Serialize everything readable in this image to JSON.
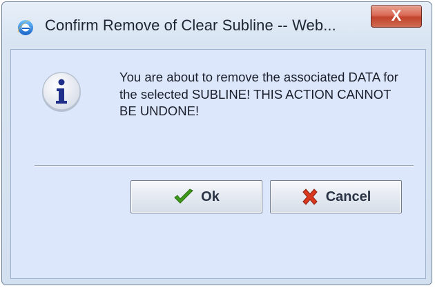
{
  "window": {
    "title": "Confirm Remove of Clear Subline -- Web...",
    "close_label": "X"
  },
  "dialog": {
    "icon": "info-icon",
    "message": "You are about to remove the associated DATA for the selected SUBLINE! THIS ACTION CANNOT BE UNDONE!",
    "ok_label": "Ok",
    "cancel_label": "Cancel"
  },
  "colors": {
    "client_bg": "#dce7fb",
    "close_button": "#c2432c",
    "ok_check": "#3f9a1b",
    "cancel_x": "#d9381e",
    "info_i": "#1f2f8a"
  }
}
